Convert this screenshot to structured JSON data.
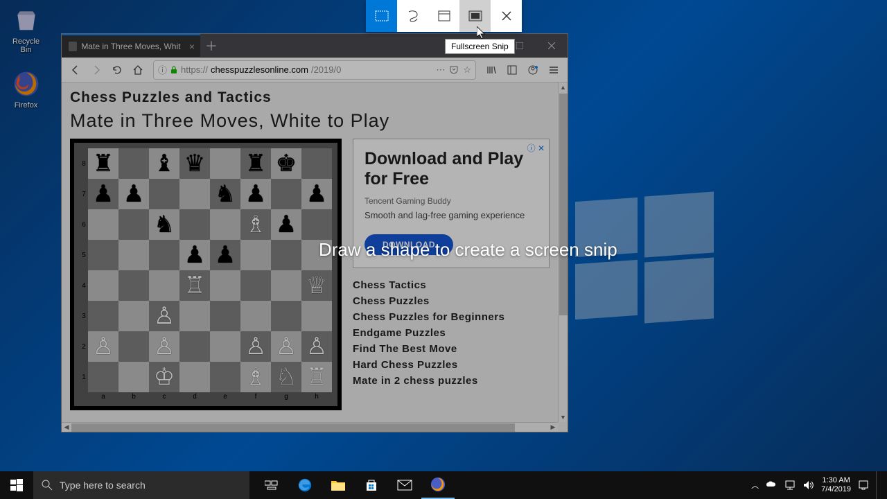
{
  "desktop": {
    "recycle_bin": "Recycle Bin",
    "firefox": "Firefox"
  },
  "snip": {
    "tooltip": "Fullscreen Snip",
    "hint": "Draw a shape to create a screen snip",
    "modes": {
      "rect": "rectangular-snip-icon",
      "freeform": "freeform-snip-icon",
      "window": "window-snip-icon",
      "fullscreen": "fullscreen-snip-icon",
      "close": "close-icon"
    }
  },
  "firefox": {
    "tab_title": "Mate in Three Moves, White to",
    "url_display": "https://chesspuzzlesonline.com/2019/0",
    "url_proto": "https://",
    "url_host": "chesspuzzlesonline.com",
    "url_path": "/2019/0"
  },
  "page": {
    "site_title": "Chess Puzzles and Tactics",
    "heading": "Mate in Three Moves, White to Play",
    "links": [
      "Chess Tactics",
      "Chess Puzzles",
      "Chess Puzzles for Beginners",
      "Endgame Puzzles",
      "Find The Best Move",
      "Hard Chess Puzzles",
      "Mate in 2 chess puzzles"
    ]
  },
  "ad": {
    "title": "Download and Play for Free",
    "subtitle": "Tencent Gaming Buddy",
    "desc": "Smooth and lag-free gaming experience",
    "button": "DOWNLOAD"
  },
  "chess": {
    "ranks": [
      "8",
      "7",
      "6",
      "5",
      "4",
      "3",
      "2",
      "1"
    ],
    "files": [
      "a",
      "b",
      "c",
      "d",
      "e",
      "f",
      "g",
      "h"
    ],
    "rows": [
      [
        "♜",
        "",
        "♝",
        "♛",
        "",
        "♜",
        "♚",
        ""
      ],
      [
        "♟",
        "♟",
        "",
        "",
        "♞",
        "♟",
        "",
        "♟"
      ],
      [
        "",
        "",
        "♞",
        "",
        "",
        "♗",
        "♟",
        ""
      ],
      [
        "",
        "",
        "",
        "♟",
        "♟",
        "",
        "",
        ""
      ],
      [
        "",
        "",
        "",
        "♖",
        "",
        "",
        "",
        "♕"
      ],
      [
        "",
        "",
        "♙",
        "",
        "",
        "",
        "",
        ""
      ],
      [
        "♙",
        "",
        "♙",
        "",
        "",
        "♙",
        "♙",
        "♙"
      ],
      [
        "",
        "",
        "♔",
        "",
        "",
        "♗",
        "♘",
        "♖"
      ]
    ]
  },
  "taskbar": {
    "search_placeholder": "Type here to search",
    "time": "1:30 AM",
    "date": "7/4/2019"
  },
  "chart_data": null
}
